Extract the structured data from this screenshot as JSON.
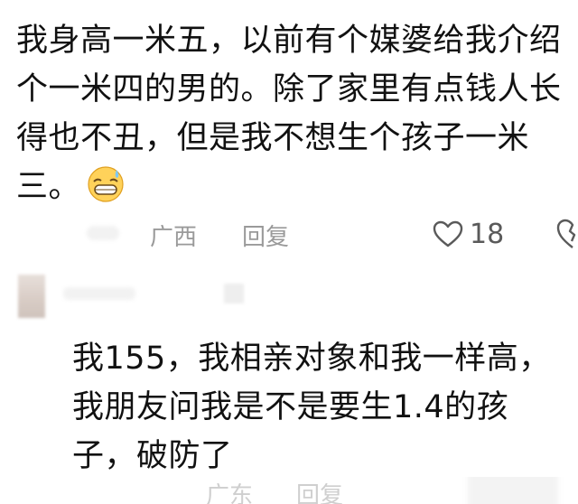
{
  "comments": [
    {
      "text": "我身高一米五，以前有个媒婆给我介绍个一米四的男的。除了家里有点钱人长得也不丑，但是我不想生个孩子一米三。",
      "emoji": "grinning-sweat-emoji",
      "location": "广西",
      "reply_label": "回复",
      "like_count": "18"
    },
    {
      "text": "我155，我相亲对象和我一样高，我朋友问我是不是要生1.4的孩子，破防了",
      "location": "广东",
      "reply_label": "回复"
    }
  ],
  "colors": {
    "text": "#111111",
    "meta": "#9a9a9a",
    "background": "#ffffff"
  }
}
